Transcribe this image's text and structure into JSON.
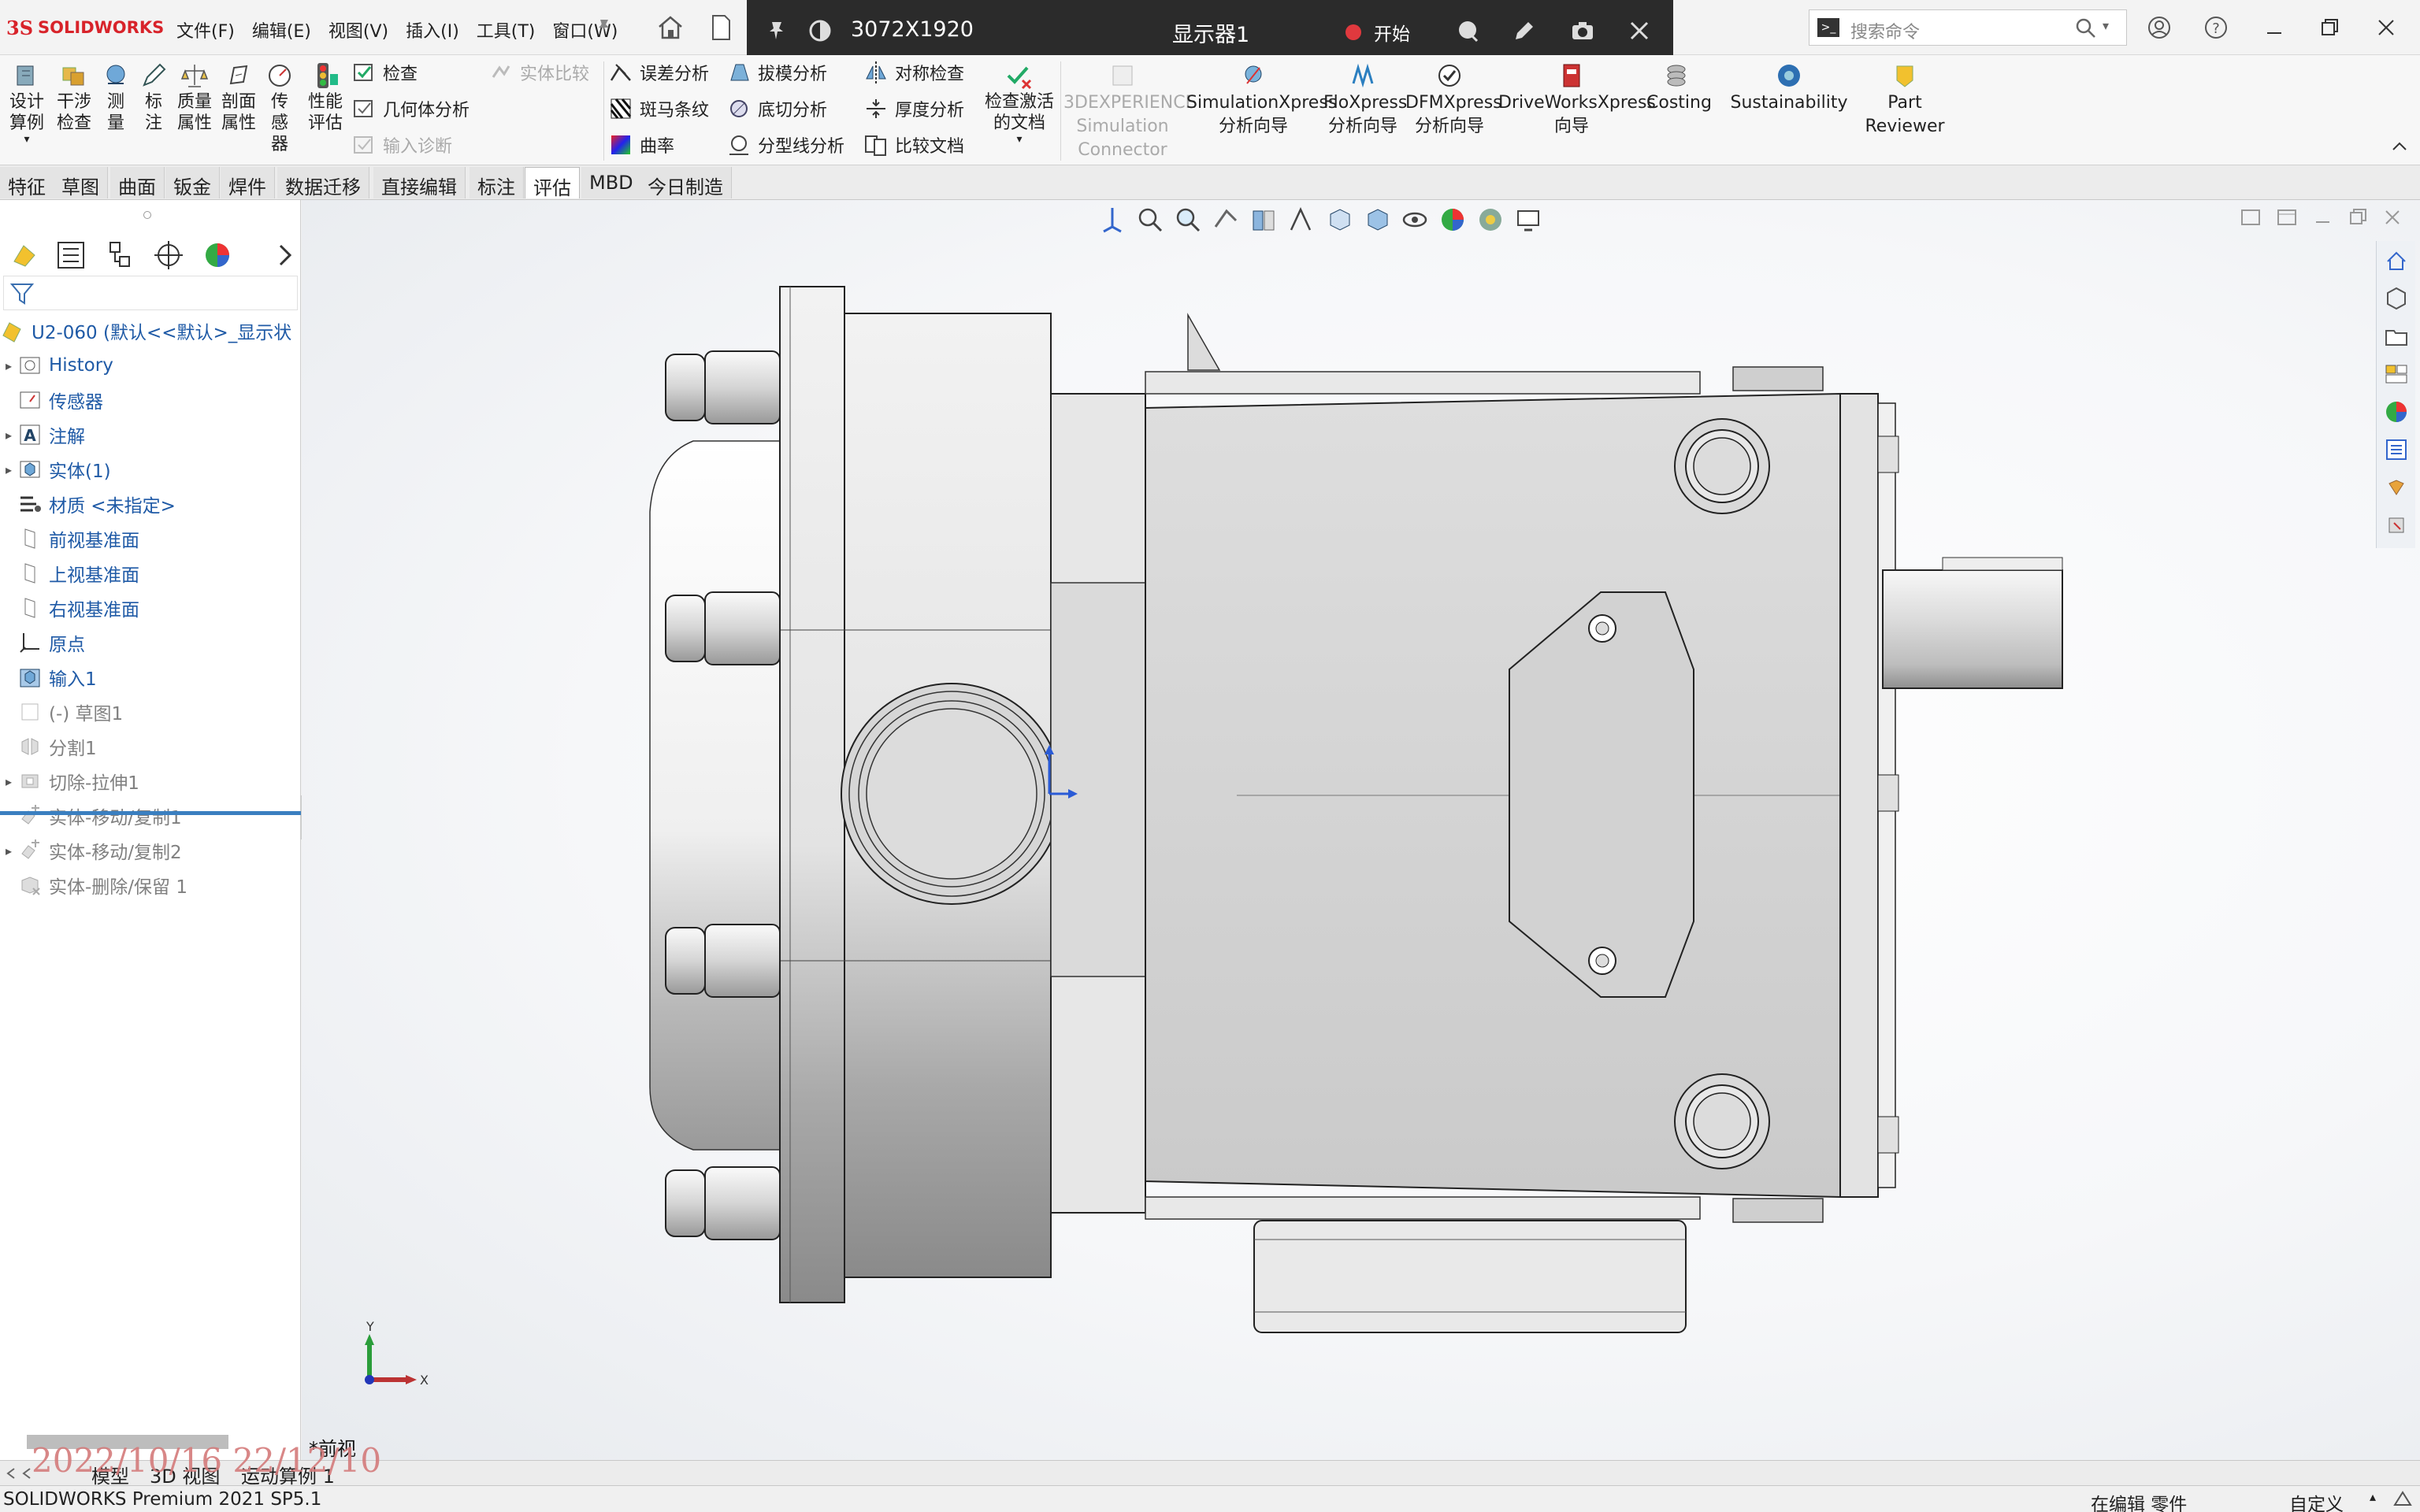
{
  "app": {
    "logo": {
      "ds": "3S",
      "name": "SOLIDWORKS"
    },
    "menu": [
      "文件(F)",
      "编辑(E)",
      "视图(V)",
      "插入(I)",
      "工具(T)",
      "窗口(W)"
    ],
    "search_placeholder": "搜索命令",
    "accent": "#d8232a"
  },
  "recorder": {
    "resolution": "3072X1920",
    "monitor": "显示器1",
    "start": "开始",
    "icons": [
      "pin-icon",
      "contrast-icon",
      "record-dot-icon",
      "chat-icon",
      "pen-icon",
      "camera-icon",
      "close-icon"
    ]
  },
  "ribbon": {
    "big": [
      {
        "label": [
          "设计",
          "算例"
        ]
      },
      {
        "label": [
          "干涉",
          "检查"
        ]
      },
      {
        "label": [
          "测",
          "量"
        ]
      },
      {
        "label": [
          "标",
          "注"
        ]
      },
      {
        "label": [
          "质量",
          "属性"
        ]
      },
      {
        "label": [
          "剖面",
          "属性"
        ]
      },
      {
        "label": [
          "传",
          "感",
          "器"
        ]
      },
      {
        "label": [
          "性能",
          "评估"
        ]
      }
    ],
    "small_col1": [
      "检查",
      "几何体分析",
      "输入诊断"
    ],
    "small_col1_disabled": "实体比较",
    "small_col2": [
      "误差分析",
      "斑马条纹",
      "曲率"
    ],
    "small_col3": [
      "拔模分析",
      "底切分析",
      "分型线分析"
    ],
    "small_col4": [
      "对称检查",
      "厚度分析",
      "比较文档"
    ],
    "check_active": [
      "检查激活",
      "的文档"
    ],
    "addins": [
      {
        "label": [
          "3DEXPERIENCE",
          "Simulation",
          "Connector"
        ],
        "disabled": true
      },
      {
        "label": [
          "SimulationXpress",
          "分析向导"
        ]
      },
      {
        "label": [
          "FloXpress",
          "分析向导"
        ]
      },
      {
        "label": [
          "DFMXpress",
          "分析向导"
        ]
      },
      {
        "label": [
          "DriveWorksXpress",
          "向导"
        ]
      },
      {
        "label": [
          "Costing"
        ]
      },
      {
        "label": [
          "Sustainability"
        ]
      },
      {
        "label": [
          "Part",
          "Reviewer"
        ]
      }
    ]
  },
  "tabs": [
    "特征",
    "草图",
    "曲面",
    "钣金",
    "焊件",
    "数据迁移",
    "直接编辑",
    "标注",
    "评估",
    "MBD",
    "今日制造"
  ],
  "active_tab": "评估",
  "tree": {
    "root": "U2-060  (默认<<默认>_显示状",
    "items": [
      {
        "label": "History",
        "expand": "▸"
      },
      {
        "label": "传感器",
        "expand": ""
      },
      {
        "label": "注解",
        "expand": "▸"
      },
      {
        "label": "实体(1)",
        "expand": "▸"
      },
      {
        "label": "材质 <未指定>",
        "expand": ""
      },
      {
        "label": "前视基准面",
        "expand": ""
      },
      {
        "label": "上视基准面",
        "expand": ""
      },
      {
        "label": "右视基准面",
        "expand": ""
      },
      {
        "label": "原点",
        "expand": ""
      },
      {
        "label": "输入1",
        "expand": ""
      },
      {
        "label": "(-) 草图1",
        "expand": ""
      },
      {
        "label": "分割1",
        "expand": ""
      },
      {
        "label": "切除-拉伸1",
        "expand": "▸"
      },
      {
        "label": "实体-移动/复制1",
        "expand": ""
      },
      {
        "label": "实体-移动/复制2",
        "expand": "▸"
      },
      {
        "label": "实体-删除/保留 1",
        "expand": ""
      }
    ]
  },
  "viewport": {
    "view_name": "*前视",
    "triad": {
      "x": "X",
      "y": "Y"
    }
  },
  "bottom_tabs": [
    "模型",
    "3D 视图",
    "运动算例 1"
  ],
  "status": {
    "left": "SOLIDWORKS Premium 2021 SP5.1",
    "mode": "在编辑 零件",
    "custom": "自定义"
  },
  "stamp": "2022/10/16 22/12/10"
}
